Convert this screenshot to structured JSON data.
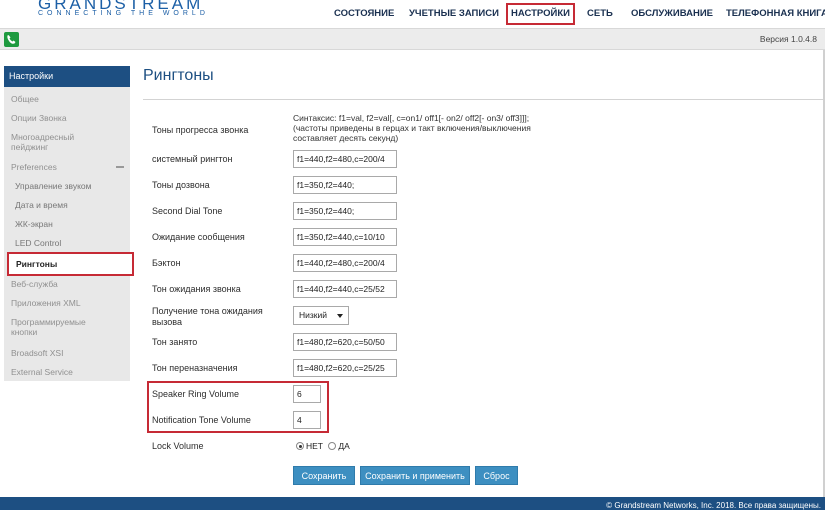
{
  "header": {
    "logo_text": "GRANDSTREAM",
    "logo_tagline": "CONNECTING THE WORLD",
    "nav": [
      "СОСТОЯНИЕ",
      "УЧЕТНЫЕ ЗАПИСИ",
      "НАСТРОЙКИ",
      "СЕТЬ",
      "ОБСЛУЖИВАНИЕ",
      "ТЕЛЕФОННАЯ КНИГА"
    ],
    "nav_active": "НАСТРОЙКИ",
    "version": "Версия 1.0.4.8"
  },
  "sidebar": {
    "title": "Настройки",
    "items": [
      {
        "label": "Общее",
        "active": false
      },
      {
        "label": "Опции Звонка",
        "active": false
      },
      {
        "label": "Многоадресный пейджинг",
        "active": false
      },
      {
        "label": "Preferences",
        "active": false,
        "expanded": true
      },
      {
        "label": "Управление звуком",
        "active": false
      },
      {
        "label": "Дата и время",
        "active": false
      },
      {
        "label": "ЖК-экран",
        "active": false
      },
      {
        "label": "LED Control",
        "active": false
      },
      {
        "label": "Рингтоны",
        "active": true
      },
      {
        "label": "Веб-служба",
        "active": false
      },
      {
        "label": "Приложения XML",
        "active": false
      },
      {
        "label": "Программируемые кнопки",
        "active": false
      },
      {
        "label": "Broadsoft XSI",
        "active": false
      },
      {
        "label": "External Service",
        "active": false
      }
    ]
  },
  "main": {
    "title": "Рингтоны",
    "call_progress_label": "Тоны прогресса звонка",
    "syntax_text": "Синтаксис: f1=val, f2=val[, c=on1/ off1[- on2/ off2[- on3/ off3]]]; (частоты приведены в герцах и такт включения/выключения составляет десять секунд)",
    "rows": [
      {
        "label": "системный рингтон",
        "value": "f1=440,f2=480,c=200/4"
      },
      {
        "label": "Тоны дозвона",
        "value": "f1=350,f2=440;"
      },
      {
        "label": "Second Dial Tone",
        "value": "f1=350,f2=440;"
      },
      {
        "label": "Ожидание сообщения",
        "value": "f1=350,f2=440,c=10/10"
      },
      {
        "label": "Бэктон",
        "value": "f1=440,f2=480,c=200/4"
      },
      {
        "label": "Тон ожидания звонка",
        "value": "f1=440,f2=440,c=25/52"
      },
      {
        "label": "Тон занято",
        "value": "f1=480,f2=620,c=50/50"
      },
      {
        "label": "Тон переназначения",
        "value": "f1=480,f2=620,c=25/25"
      }
    ],
    "call_waiting_gain_label": "Получение тона ожидания вызова",
    "call_waiting_gain_value": "Низкий",
    "speaker_ring_volume_label": "Speaker Ring Volume",
    "speaker_ring_volume_value": "6",
    "notification_tone_volume_label": "Notification Tone Volume",
    "notification_tone_volume_value": "4",
    "lock_volume_label": "Lock Volume",
    "lock_volume_options": [
      "НЕТ",
      "ДА"
    ],
    "lock_volume_selected": "НЕТ",
    "buttons": {
      "save": "Сохранить",
      "save_apply": "Сохранить и применить",
      "reset": "Сброс"
    }
  },
  "footer": {
    "copyright": "© Grandstream Networks, Inc. 2018. Все права защищены."
  },
  "colors": {
    "brand_blue": "#1d4f82",
    "button_blue": "#3d8fc1",
    "highlight_red": "#c62a35",
    "phone_green": "#1e9a3f"
  }
}
